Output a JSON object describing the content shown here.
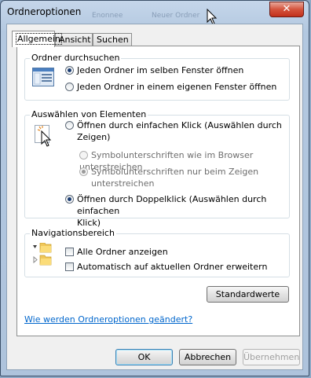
{
  "window": {
    "title": "Ordneroptionen",
    "close_glyph": "✕",
    "ghost_text_1": "Enonnee",
    "ghost_text_2": "Neuer Ordner"
  },
  "tabs": [
    {
      "label": "Allgemein",
      "active": true
    },
    {
      "label": "Ansicht",
      "active": false
    },
    {
      "label": "Suchen",
      "active": false
    }
  ],
  "browse": {
    "title": "Ordner durchsuchen",
    "options": [
      {
        "label": "Jeden Ordner im selben Fenster öffnen",
        "selected": true
      },
      {
        "label": "Jeden Ordner in einem eigenen Fenster öffnen",
        "selected": false
      }
    ]
  },
  "select_items": {
    "title": "Auswählen von Elementen",
    "single_click": {
      "label_line1": "Öffnen durch einfachen Klick (Auswählen durch",
      "label_line2": "Zeigen)",
      "selected": false
    },
    "underline_browser": {
      "label": "Symbolunterschriften wie im Browser unterstreichen",
      "selected": false,
      "enabled": false
    },
    "underline_hover": {
      "label_line1": "Symbolunterschriften nur beim Zeigen",
      "label_line2": "unterstreichen",
      "selected": true,
      "enabled": false
    },
    "double_click": {
      "label_line1": "Öffnen durch Doppelklick (Auswählen durch einfachen",
      "label_line2": "Klick)",
      "selected": true
    }
  },
  "navigation": {
    "title": "Navigationsbereich",
    "options": [
      {
        "label": "Alle Ordner anzeigen",
        "checked": false
      },
      {
        "label": "Automatisch auf aktuellen Ordner erweitern",
        "checked": false
      }
    ]
  },
  "restore_defaults_label": "Standardwerte",
  "help_link": "Wie werden Ordneroptionen geändert?",
  "buttons": {
    "ok": "OK",
    "cancel": "Abbrechen",
    "apply": "Übernehmen"
  },
  "colors": {
    "link": "#0066cc",
    "close": "#c2301b",
    "radio_dot": "#1b3c72"
  }
}
